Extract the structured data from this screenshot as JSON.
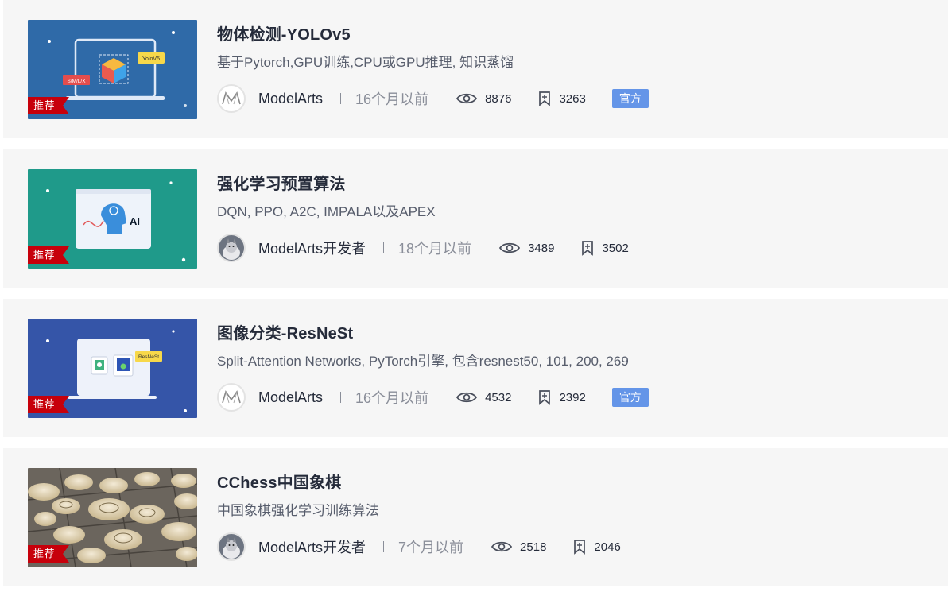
{
  "items": [
    {
      "title": "物体检测-YOLOv5",
      "description": "基于Pytorch,GPU训练,CPU或GPU推理, 知识蒸馏",
      "author": "ModelArts",
      "time": "16个月以前",
      "views": "8876",
      "favorites": "3263",
      "ribbon": "推荐",
      "badge": "官方",
      "thumb_tags": [
        "YoloV5",
        "S/M/L/X"
      ]
    },
    {
      "title": "强化学习预置算法",
      "description": "DQN, PPO, A2C, IMPALA以及APEX",
      "author": "ModelArts开发者",
      "time": "18个月以前",
      "views": "3489",
      "favorites": "3502",
      "ribbon": "推荐",
      "thumb_tags": [
        "AI"
      ]
    },
    {
      "title": "图像分类-ResNeSt",
      "description": "Split-Attention Networks, PyTorch引擎, 包含resnest50, 101, 200, 269",
      "author": "ModelArts",
      "time": "16个月以前",
      "views": "4532",
      "favorites": "2392",
      "ribbon": "推荐",
      "badge": "官方",
      "thumb_tags": [
        "ResNeSt"
      ]
    },
    {
      "title": "CChess中国象棋",
      "description": "中国象棋强化学习训练算法",
      "author": "ModelArts开发者",
      "time": "7个月以前",
      "views": "2518",
      "favorites": "2046",
      "ribbon": "推荐"
    }
  ],
  "colors": {
    "ribbon": "#c7000b",
    "badge": "#6495e8",
    "card_bg": "#f6f6f6",
    "thumb1_bg": "#2f6aa8",
    "thumb2_bg": "#1f9a8a",
    "thumb3_bg": "#3555a8"
  },
  "icons": {
    "views": "eye-icon",
    "favorites": "bookmark-plus-icon",
    "official_avatar": "modelarts-logo-icon",
    "dev_avatar": "cat-avatar-icon"
  }
}
